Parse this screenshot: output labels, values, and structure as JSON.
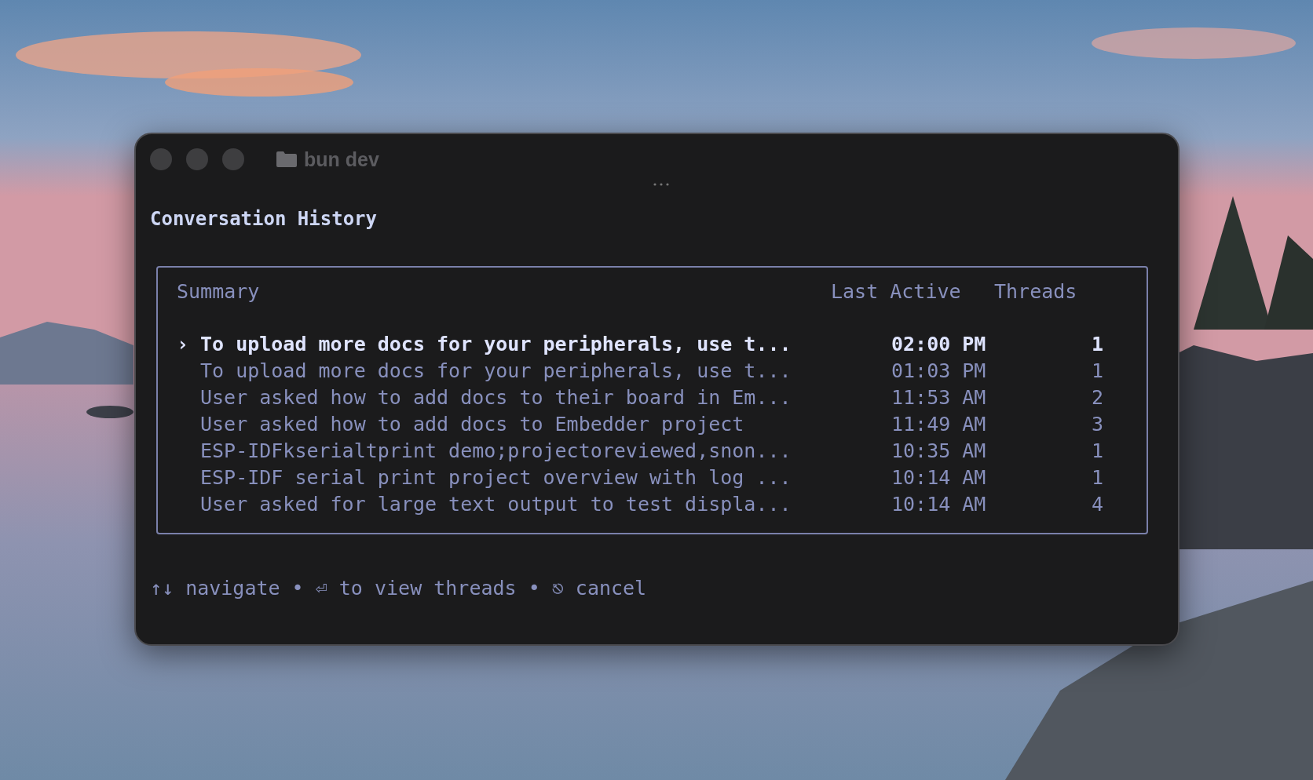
{
  "window": {
    "title": "bun dev"
  },
  "heading": "Conversation History",
  "table": {
    "columns": [
      "Summary",
      "Last Active",
      "Threads"
    ],
    "cursor": "›",
    "rows": [
      {
        "summary": "To upload more docs for your peripherals, use t...",
        "last_active": "02:00 PM",
        "threads": "1",
        "selected": true
      },
      {
        "summary": "To upload more docs for your peripherals, use t...",
        "last_active": "01:03 PM",
        "threads": "1",
        "selected": false
      },
      {
        "summary": "User asked how to add docs to their board in Em...",
        "last_active": "11:53 AM",
        "threads": "2",
        "selected": false
      },
      {
        "summary": "User asked how to add docs to Embedder project",
        "last_active": "11:49 AM",
        "threads": "3",
        "selected": false
      },
      {
        "summary": "ESP-IDFkserialtprint demo;projectoreviewed,snon...",
        "last_active": "10:35 AM",
        "threads": "1",
        "selected": false
      },
      {
        "summary": "ESP-IDF serial print project overview with log ...",
        "last_active": "10:14 AM",
        "threads": "1",
        "selected": false
      },
      {
        "summary": "User asked for large text output to test displa...",
        "last_active": "10:14 AM",
        "threads": "4",
        "selected": false
      }
    ]
  },
  "footer": "↑↓ navigate • ⏎ to view threads • ⎋ cancel"
}
